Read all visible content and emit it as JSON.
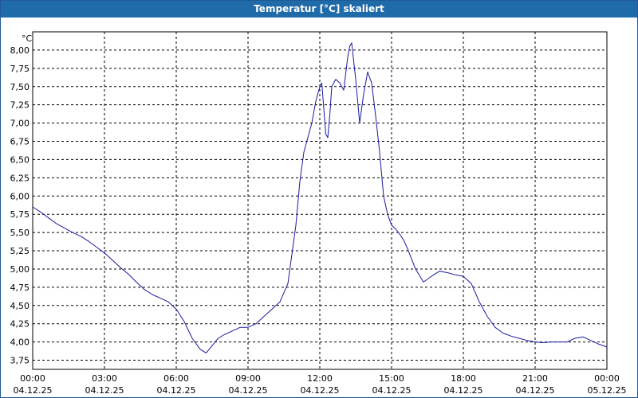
{
  "window": {
    "title": "Temperatur [°C] skaliert"
  },
  "chart_data": {
    "type": "line",
    "title": "Temperatur [°C] skaliert",
    "xlabel": "",
    "ylabel": "°C",
    "ylim": [
      3.625,
      8.25
    ],
    "xlim": [
      "04.12.25 00:00",
      "05.12.25 00:00"
    ],
    "grid": true,
    "y_ticks": [
      "3,75",
      "4,00",
      "4,25",
      "4,50",
      "4,75",
      "5,00",
      "5,25",
      "5,50",
      "5,75",
      "6,00",
      "6,25",
      "6,50",
      "6,75",
      "7,00",
      "7,25",
      "7,50",
      "7,75",
      "8,00"
    ],
    "y_tick_values": [
      3.75,
      4.0,
      4.25,
      4.5,
      4.75,
      5.0,
      5.25,
      5.5,
      5.75,
      6.0,
      6.25,
      6.5,
      6.75,
      7.0,
      7.25,
      7.5,
      7.75,
      8.0
    ],
    "x_ticks": [
      {
        "time": "00:00",
        "date": "04.12.25"
      },
      {
        "time": "03:00",
        "date": "04.12.25"
      },
      {
        "time": "06:00",
        "date": "04.12.25"
      },
      {
        "time": "09:00",
        "date": "04.12.25"
      },
      {
        "time": "12:00",
        "date": "04.12.25"
      },
      {
        "time": "15:00",
        "date": "04.12.25"
      },
      {
        "time": "18:00",
        "date": "04.12.25"
      },
      {
        "time": "21:00",
        "date": "04.12.25"
      },
      {
        "time": "00:00",
        "date": "05.12.25"
      }
    ],
    "series": [
      {
        "color": "#1a1aa0",
        "x": [
          "00:00",
          "00:20",
          "00:40",
          "01:00",
          "01:20",
          "01:40",
          "02:00",
          "02:20",
          "02:40",
          "03:00",
          "03:20",
          "03:40",
          "04:00",
          "04:20",
          "04:40",
          "05:00",
          "05:20",
          "05:40",
          "06:00",
          "06:20",
          "06:40",
          "07:00",
          "07:15",
          "07:30",
          "07:45",
          "08:00",
          "08:20",
          "08:40",
          "09:00",
          "09:20",
          "09:40",
          "10:00",
          "10:20",
          "10:40",
          "11:00",
          "11:10",
          "11:20",
          "11:30",
          "11:40",
          "11:50",
          "12:00",
          "12:05",
          "12:10",
          "12:15",
          "12:20",
          "12:25",
          "12:30",
          "12:40",
          "12:50",
          "13:00",
          "13:10",
          "13:15",
          "13:20",
          "13:30",
          "13:40",
          "13:50",
          "14:00",
          "14:10",
          "14:20",
          "14:30",
          "14:40",
          "14:50",
          "15:00",
          "15:10",
          "15:20",
          "15:30",
          "15:40",
          "16:00",
          "16:20",
          "16:40",
          "17:00",
          "17:20",
          "17:40",
          "18:00",
          "18:20",
          "18:40",
          "19:00",
          "19:20",
          "19:40",
          "20:00",
          "20:20",
          "20:40",
          "21:00",
          "21:20",
          "21:40",
          "22:00",
          "22:20",
          "22:40",
          "23:00",
          "23:20",
          "23:40",
          "24:00"
        ],
        "y": [
          5.85,
          5.78,
          5.7,
          5.62,
          5.56,
          5.5,
          5.45,
          5.38,
          5.3,
          5.22,
          5.12,
          5.02,
          4.93,
          4.82,
          4.72,
          4.65,
          4.6,
          4.55,
          4.45,
          4.28,
          4.05,
          3.9,
          3.85,
          3.95,
          4.05,
          4.1,
          4.15,
          4.2,
          4.2,
          4.25,
          4.35,
          4.45,
          4.55,
          4.8,
          5.6,
          6.2,
          6.6,
          6.8,
          7.0,
          7.3,
          7.5,
          7.55,
          7.2,
          6.85,
          6.8,
          7.1,
          7.5,
          7.6,
          7.55,
          7.45,
          7.9,
          8.05,
          8.1,
          7.6,
          7.0,
          7.4,
          7.7,
          7.55,
          7.1,
          6.6,
          6.0,
          5.75,
          5.6,
          5.55,
          5.48,
          5.4,
          5.28,
          5.0,
          4.82,
          4.9,
          4.97,
          4.95,
          4.92,
          4.9,
          4.8,
          4.55,
          4.35,
          4.2,
          4.12,
          4.08,
          4.05,
          4.02,
          4.0,
          3.99,
          4.0,
          4.0,
          4.0,
          4.05,
          4.07,
          4.02,
          3.97,
          3.93
        ]
      }
    ]
  }
}
